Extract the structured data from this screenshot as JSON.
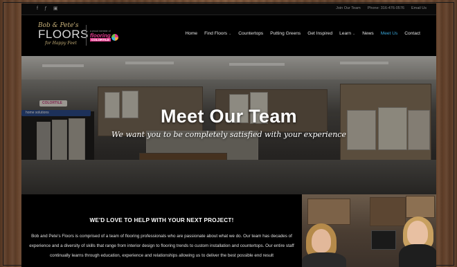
{
  "topbar": {
    "social": [
      {
        "icon": "facebook-icon",
        "glyph": "f"
      },
      {
        "icon": "foursquare-icon",
        "glyph": "ƒ"
      },
      {
        "icon": "instagram-icon",
        "glyph": "▣"
      }
    ],
    "links": [
      {
        "label": "Join Our Team"
      },
      {
        "label": "Phone: 316-476-0576"
      },
      {
        "label": "Email Us"
      }
    ]
  },
  "header": {
    "logo": {
      "line1": "Bob & Pete's",
      "line2": "FLOORS",
      "line3": "for Happy Feet"
    },
    "partner": {
      "line1": "a proud member of",
      "line2": "flooring",
      "line3": "COLORTILE"
    },
    "nav": [
      {
        "label": "Home",
        "active": false,
        "dropdown": false
      },
      {
        "label": "Find Floors",
        "active": false,
        "dropdown": true
      },
      {
        "label": "Countertops",
        "active": false,
        "dropdown": false
      },
      {
        "label": "Putting Greens",
        "active": false,
        "dropdown": false
      },
      {
        "label": "Get Inspired",
        "active": false,
        "dropdown": false
      },
      {
        "label": "Learn",
        "active": false,
        "dropdown": true
      },
      {
        "label": "News",
        "active": false,
        "dropdown": false
      },
      {
        "label": "Meet Us",
        "active": true,
        "dropdown": false
      },
      {
        "label": "Contact",
        "active": false,
        "dropdown": false
      }
    ],
    "accent_color": "#3aa6d8"
  },
  "hero": {
    "title": "Meet Our Team",
    "subtitle": "We want you to be completely satisfied with your experience",
    "signs": [
      "COLORTILE",
      "home solutions"
    ]
  },
  "content": {
    "heading": "WE'D LOVE TO HELP WITH YOUR NEXT PROJECT!",
    "body": "Bob and Pete's Floors is comprised of a team of flooring professionals who are passionate about what we do. Our team has decades of experience and a diversity of skills that range from interior design to flooring trends to custom installation and countertops. Our entire staff continually learns through education, experience and relationships allowing us to deliver the best possible end result"
  }
}
